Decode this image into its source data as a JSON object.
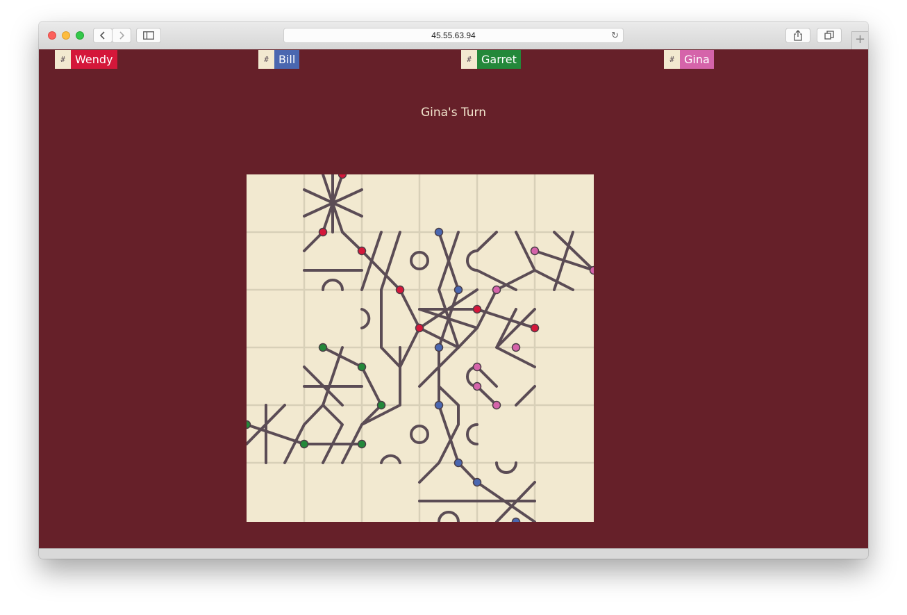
{
  "browser": {
    "url": "45.55.63.94"
  },
  "players": [
    {
      "symbol": "#",
      "name": "Wendy",
      "color": "#d4173a"
    },
    {
      "symbol": "#",
      "name": "Bill",
      "color": "#4a67b0"
    },
    {
      "symbol": "#",
      "name": "Garret",
      "color": "#23883a"
    },
    {
      "symbol": "#",
      "name": "Gina",
      "color": "#d564aa"
    }
  ],
  "game": {
    "turn_text": "Gina's Turn"
  },
  "colors": {
    "page_background": "#662029",
    "board_background": "#f2e9d0",
    "board_grid": "#d8d0b8",
    "track": "#5b4c55"
  }
}
